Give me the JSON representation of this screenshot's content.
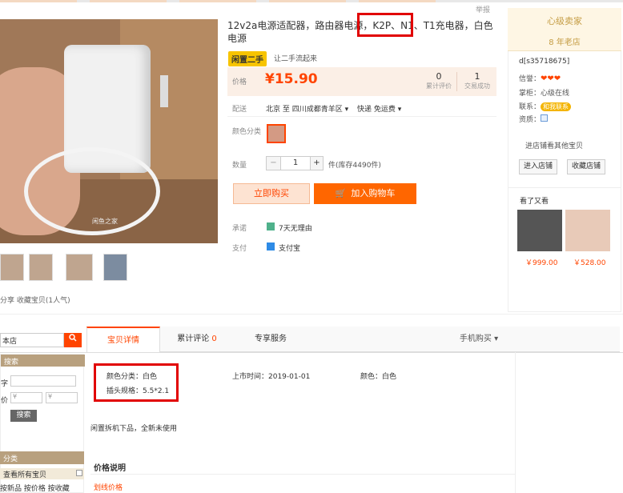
{
  "header": {
    "report": "举报"
  },
  "gallery": {
    "watermark": "闲鱼之家",
    "share": "分享 收藏宝贝(1人气)"
  },
  "product": {
    "title": "12v2a电源适配器，路由器电源，K2P、N1、T1充电器，白色电源",
    "badge": "闲置二手",
    "badge_note": "让二手流起来",
    "price_label": "价格",
    "price": "¥15.90",
    "stats": [
      {
        "value": "0",
        "label": "累计评价"
      },
      {
        "value": "1",
        "label": "交易成功"
      }
    ],
    "ship_label": "配送",
    "ship_from": "北京 至 四川成都青羊区 ▾",
    "ship_method": "快递 免运费 ▾",
    "color_label": "颜色分类",
    "qty_label": "数量",
    "qty_value": "1",
    "qty_minus": "−",
    "qty_plus": "+",
    "stock_note": "件(库存4490件)",
    "buy_now": "立即购买",
    "add_cart": "加入购物车",
    "cart_glyph": "🛒",
    "svc1_label": "承诺",
    "svc1_text": "7天无理由",
    "svc2_label": "支付",
    "svc2_text": "支付宝"
  },
  "shop": {
    "name": "心级卖家",
    "age": "8 年老店",
    "seller_id": "d[s35718675]",
    "credit_label": "信誉：",
    "hearts": "❤❤❤",
    "location_label": "掌柜：",
    "location": "心级在线",
    "contact_label": "联系：",
    "contact_badge": "和我联系",
    "qual_label": "资质：",
    "view_favs": "进店铺看其他宝贝",
    "enter_shop": "进入店铺",
    "collect_shop": "收藏店铺",
    "seen_label": "看了又看",
    "seen": [
      {
        "price": "￥999.00"
      },
      {
        "price": "￥528.00"
      }
    ]
  },
  "left": {
    "search_placeholder": "本店",
    "search_icon": "search-icon",
    "panel_title": "搜索",
    "kw_label": "字",
    "price_label": "价",
    "min_ph": "¥",
    "max_ph": "¥",
    "search_go": "搜索",
    "cat_title": "分类",
    "cat1": "查看所有宝贝",
    "cat2": "按新品 按价格 按收藏"
  },
  "tabs": {
    "detail": "宝贝详情",
    "reviews": "累计评论",
    "reviews_count": "0",
    "service": "专享服务",
    "mobile": "手机购买 ▾"
  },
  "attrs": {
    "color": "颜色分类：白色",
    "spec": "插头规格：5.5*2.1",
    "listed": "上市时间：2019-01-01",
    "color2": "颜色：白色"
  },
  "desc": "闲置拆机下品，全新未使用",
  "price_desc": "价格说明",
  "price_link": "划线价格"
}
